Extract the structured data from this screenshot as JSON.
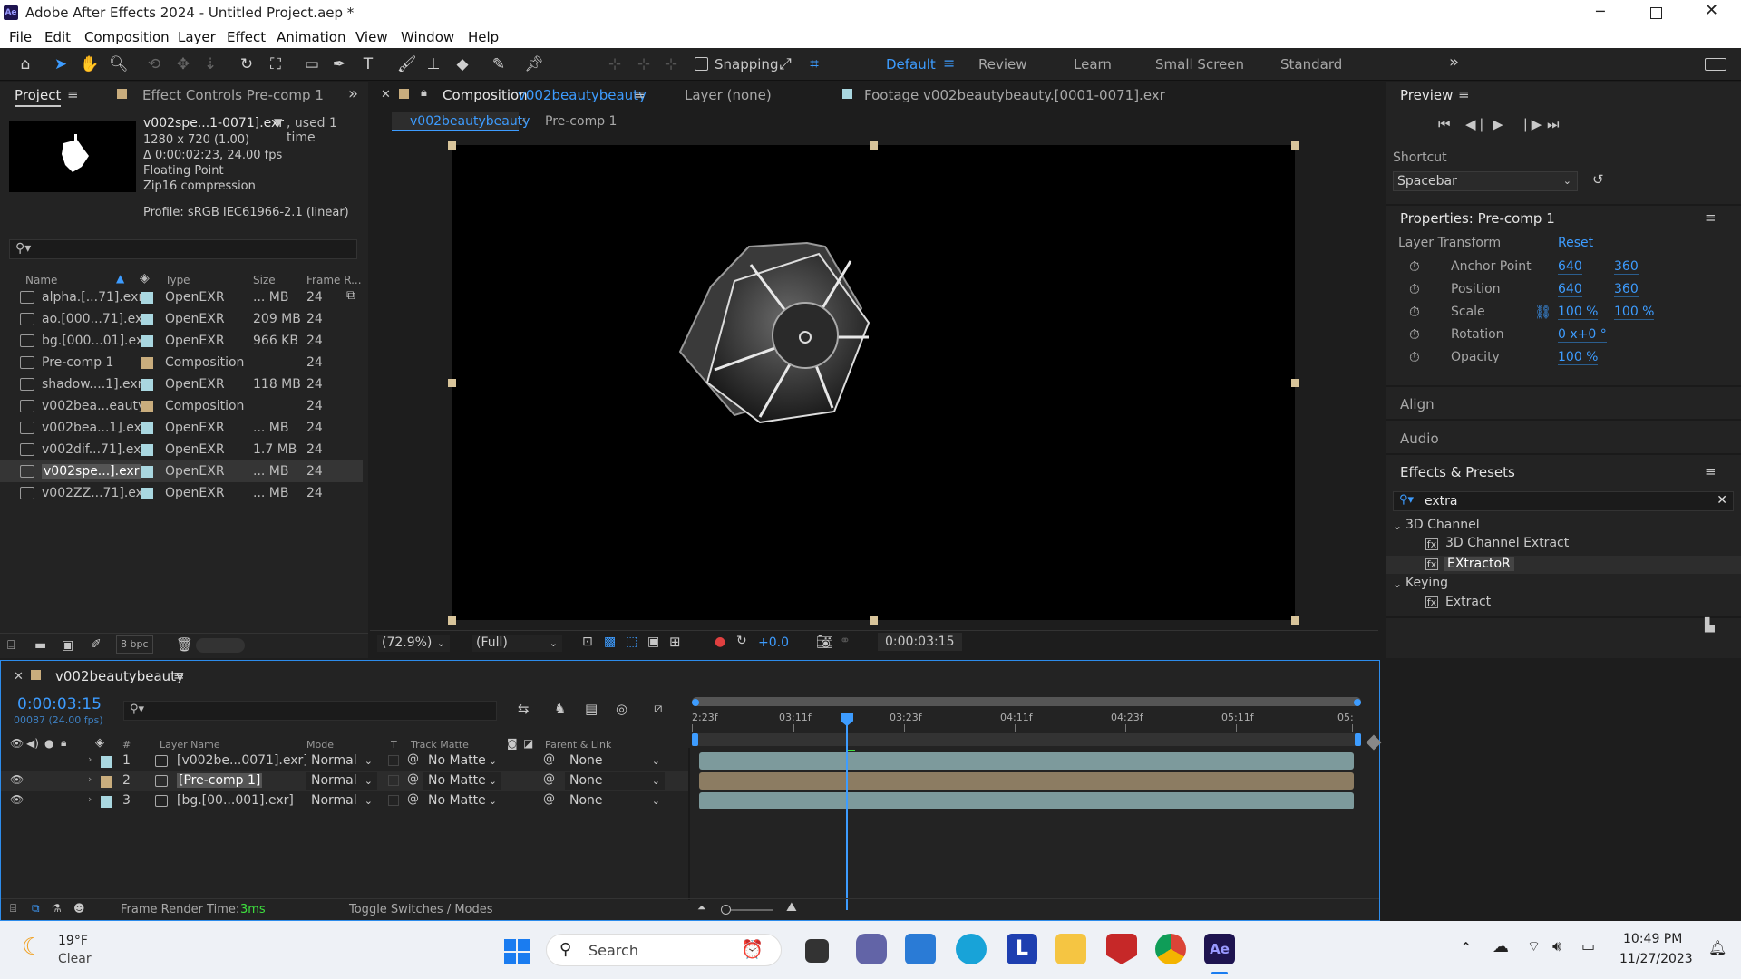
{
  "window": {
    "title": "Adobe After Effects 2024 - Untitled Project.aep *",
    "app_icon": "Ae"
  },
  "menu": [
    "File",
    "Edit",
    "Composition",
    "Layer",
    "Effect",
    "Animation",
    "View",
    "Window",
    "Help"
  ],
  "toolbar": {
    "snapping": "Snapping",
    "workspaces": [
      "Default",
      "Review",
      "Learn",
      "Small Screen",
      "Standard"
    ]
  },
  "project": {
    "tab_project": "Project",
    "tab_effect_controls": "Effect Controls Pre-comp 1",
    "selected_file": "v002spe...1-0071].exr",
    "used": ", used 1 time",
    "info": [
      "1280 x 720 (1.00)",
      "Δ 0:00:02:23, 24.00 fps",
      "Floating Point",
      "Zip16 compression"
    ],
    "profile": "Profile: sRGB IEC61966-2.1 (linear)",
    "columns": {
      "name": "Name",
      "type": "Type",
      "size": "Size",
      "frame": "Frame R..."
    },
    "items": [
      {
        "name": "alpha.[...71].exr",
        "type": "OpenEXR",
        "size": "... MB",
        "fr": "24",
        "color": "#a9d7e0"
      },
      {
        "name": "ao.[000...71].exr",
        "type": "OpenEXR",
        "size": "209 MB",
        "fr": "24",
        "color": "#a9d7e0"
      },
      {
        "name": "bg.[000...01].exr",
        "type": "OpenEXR",
        "size": "966 KB",
        "fr": "24",
        "color": "#a9d7e0"
      },
      {
        "name": "Pre-comp 1",
        "type": "Composition",
        "size": "",
        "fr": "24",
        "color": "#c9ad7d"
      },
      {
        "name": "shadow....1].exr",
        "type": "OpenEXR",
        "size": "118 MB",
        "fr": "24",
        "color": "#a9d7e0"
      },
      {
        "name": "v002bea...eauty",
        "type": "Composition",
        "size": "",
        "fr": "24",
        "color": "#c9ad7d"
      },
      {
        "name": "v002bea...1].exr",
        "type": "OpenEXR",
        "size": "... MB",
        "fr": "24",
        "color": "#a9d7e0"
      },
      {
        "name": "v002dif...71].exr",
        "type": "OpenEXR",
        "size": "1.7 MB",
        "fr": "24",
        "color": "#a9d7e0"
      },
      {
        "name": "v002spe...].exr",
        "type": "OpenEXR",
        "size": "... MB",
        "fr": "24",
        "color": "#a9d7e0"
      },
      {
        "name": "v002ZZ...71].exr",
        "type": "OpenEXR",
        "size": "... MB",
        "fr": "24",
        "color": "#a9d7e0"
      }
    ],
    "bpc": "8 bpc"
  },
  "comp": {
    "tab_comp_prefix": "Composition",
    "tab_comp_name": "v002beautybeauty",
    "tab_layer": "Layer  (none)",
    "tab_footage": "Footage  v002beautybeauty.[0001-0071].exr",
    "crumb1": "v002beautybeauty",
    "crumb2": "Pre-comp 1",
    "zoom": "(72.9%)",
    "resolution": "(Full)",
    "exposure": "+0.0",
    "timecode": "0:00:03:15"
  },
  "preview": {
    "title": "Preview",
    "shortcut_label": "Shortcut",
    "shortcut": "Spacebar"
  },
  "properties": {
    "title": "Properties: Pre-comp 1",
    "section": "Layer Transform",
    "reset": "Reset",
    "rows": [
      {
        "label": "Anchor Point",
        "v1": "640",
        "v2": "360"
      },
      {
        "label": "Position",
        "v1": "640",
        "v2": "360"
      },
      {
        "label": "Scale",
        "v1": "100 %",
        "v2": "100 %"
      },
      {
        "label": "Rotation",
        "v1": "0 x+0 °",
        "v2": ""
      },
      {
        "label": "Opacity",
        "v1": "100 %",
        "v2": ""
      }
    ]
  },
  "align": "Align",
  "audio": "Audio",
  "effects": {
    "title": "Effects & Presets",
    "search": "extra",
    "groups": [
      {
        "name": "3D Channel",
        "items": [
          "3D Channel Extract",
          "EXtractoR"
        ]
      },
      {
        "name": "Keying",
        "items": [
          "Extract"
        ]
      }
    ]
  },
  "timeline": {
    "comp_name": "v002beautybeauty",
    "timecode": "0:00:03:15",
    "frames": "00087 (24.00 fps)",
    "cols": {
      "num": "#",
      "layer": "Layer Name",
      "mode": "Mode",
      "t": "T",
      "matte": "Track Matte",
      "parent": "Parent & Link"
    },
    "ruler": [
      "2:23f",
      "03:11f",
      "03:23f",
      "04:11f",
      "04:23f",
      "05:11f",
      "05:"
    ],
    "layers": [
      {
        "num": "1",
        "name": "[v002be...0071].exr]",
        "mode": "Normal",
        "matte": "No Matte",
        "parent": "None",
        "color": "#a9d7e0",
        "bar": "#7d9a9c"
      },
      {
        "num": "2",
        "name": "[Pre-comp 1]",
        "mode": "Normal",
        "matte": "No Matte",
        "parent": "None",
        "color": "#c9ad7d",
        "bar": "#8c7c62"
      },
      {
        "num": "3",
        "name": "[bg.[00...001].exr]",
        "mode": "Normal",
        "matte": "No Matte",
        "parent": "None",
        "color": "#a9d7e0",
        "bar": "#7d9a9c"
      }
    ],
    "render_label": "Frame Render Time:",
    "render_value": "3ms",
    "toggle": "Toggle Switches / Modes"
  },
  "taskbar": {
    "weather_temp": "19°F",
    "weather_desc": "Clear",
    "search": "Search",
    "time": "10:49 PM",
    "date": "11/27/2023"
  }
}
